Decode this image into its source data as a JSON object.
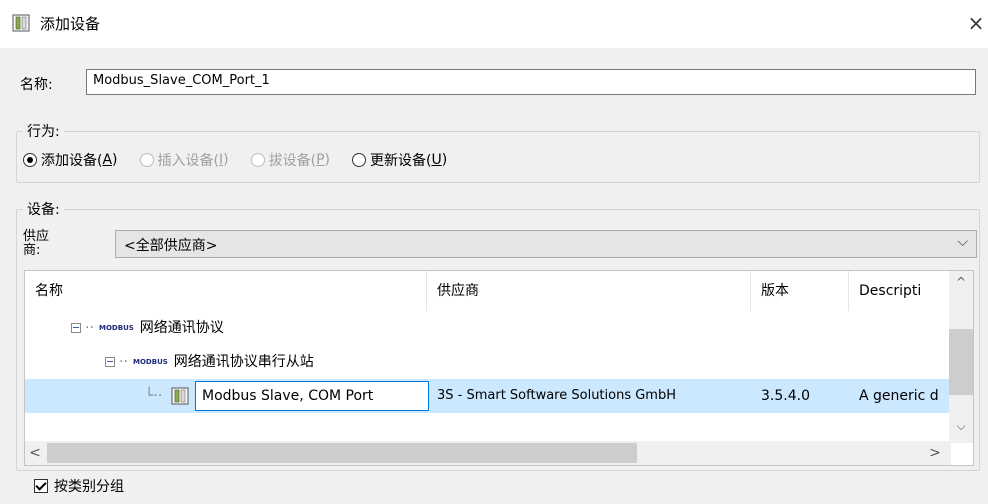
{
  "window": {
    "title": "添加设备",
    "close_glyph": "×"
  },
  "name_field": {
    "label": "名称:",
    "value": "Modbus_Slave_COM_Port_1"
  },
  "behavior": {
    "legend": "行为:",
    "options": [
      {
        "label": "添加设备(",
        "hotkey": "A",
        "suffix": ")",
        "checked": true,
        "disabled": false
      },
      {
        "label": "插入设备(",
        "hotkey": "I",
        "suffix": ")",
        "checked": false,
        "disabled": true
      },
      {
        "label": "拔设备(",
        "hotkey": "P",
        "suffix": ")",
        "checked": false,
        "disabled": true
      },
      {
        "label": "更新设备(",
        "hotkey": "U",
        "suffix": ")",
        "checked": false,
        "disabled": false
      }
    ]
  },
  "device": {
    "legend": "设备:",
    "vendor_label_line1": "供应",
    "vendor_label_line2": "商:",
    "vendor_value": "<全部供应商>",
    "columns": [
      "名称",
      "供应商",
      "版本",
      "Descripti"
    ],
    "tree": {
      "level1": {
        "tag": "MODBUS",
        "label": "网络通讯协议"
      },
      "level2": {
        "tag": "MODBUS",
        "label": "网络通讯协议串行从站"
      },
      "selected": {
        "name": "Modbus Slave, COM Port",
        "vendor": "3S - Smart Software Solutions GmbH",
        "version": "3.5.4.0",
        "description": "A generic d"
      }
    }
  },
  "group_by_category": {
    "label": "按类别分组",
    "checked": true
  },
  "colors": {
    "selection": "#cce8ff",
    "focus_border": "#0078d7",
    "dialog_bg": "#f0f0f0"
  }
}
